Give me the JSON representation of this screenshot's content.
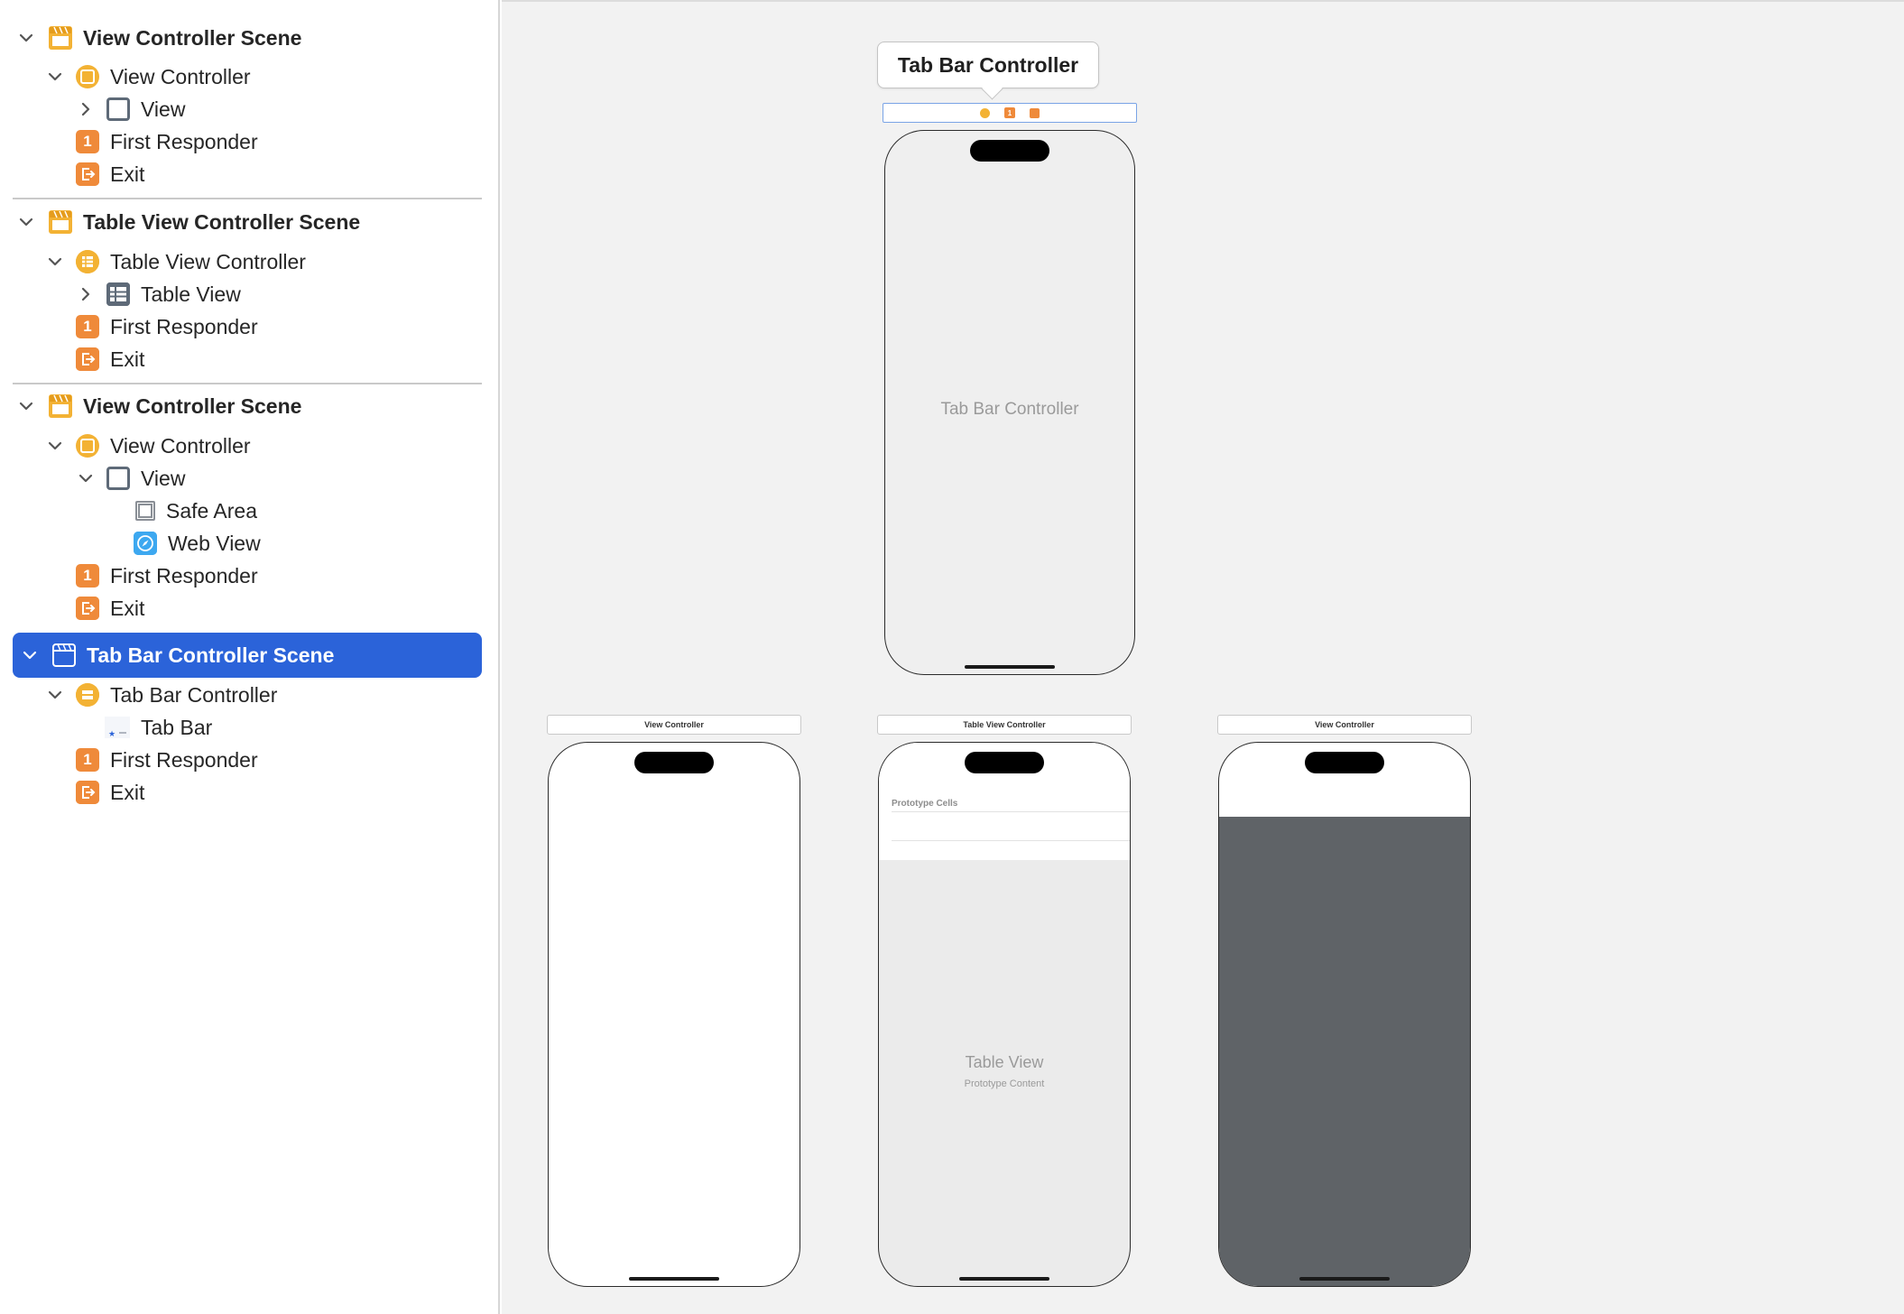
{
  "outline": {
    "scenes": [
      {
        "title": "View Controller Scene",
        "items": [
          {
            "label": "View Controller"
          },
          {
            "label": "View"
          },
          {
            "label": "First Responder",
            "badge": "1"
          },
          {
            "label": "Exit"
          }
        ]
      },
      {
        "title": "Table View Controller Scene",
        "items": [
          {
            "label": "Table View Controller"
          },
          {
            "label": "Table View"
          },
          {
            "label": "First Responder",
            "badge": "1"
          },
          {
            "label": "Exit"
          }
        ]
      },
      {
        "title": "View Controller Scene",
        "items": [
          {
            "label": "View Controller"
          },
          {
            "label": "View"
          },
          {
            "label": "Safe Area"
          },
          {
            "label": "Web View"
          },
          {
            "label": "First Responder",
            "badge": "1"
          },
          {
            "label": "Exit"
          }
        ]
      },
      {
        "title": "Tab Bar Controller Scene",
        "items": [
          {
            "label": "Tab Bar Controller"
          },
          {
            "label": "Tab Bar"
          },
          {
            "label": "First Responder",
            "badge": "1"
          },
          {
            "label": "Exit"
          }
        ]
      }
    ]
  },
  "canvas": {
    "callout_title": "Tab Bar Controller",
    "dock_badge": "1",
    "tab_bar_scene": {
      "center_label": "Tab Bar Controller"
    },
    "scene1": {
      "header": "View Controller"
    },
    "scene2": {
      "header": "Table View Controller",
      "section_header": "Prototype Cells",
      "center_title": "Table View",
      "center_subtitle": "Prototype Content"
    },
    "scene3": {
      "header": "View Controller"
    }
  },
  "colors": {
    "selection": "#2b63d9",
    "scene_icon": "#f3b234",
    "responder_icon": "#ef8a3a",
    "web_view_icon": "#3da8f0",
    "canvas_bg": "#f2f2f2",
    "web_view_bg": "#5f6367"
  }
}
